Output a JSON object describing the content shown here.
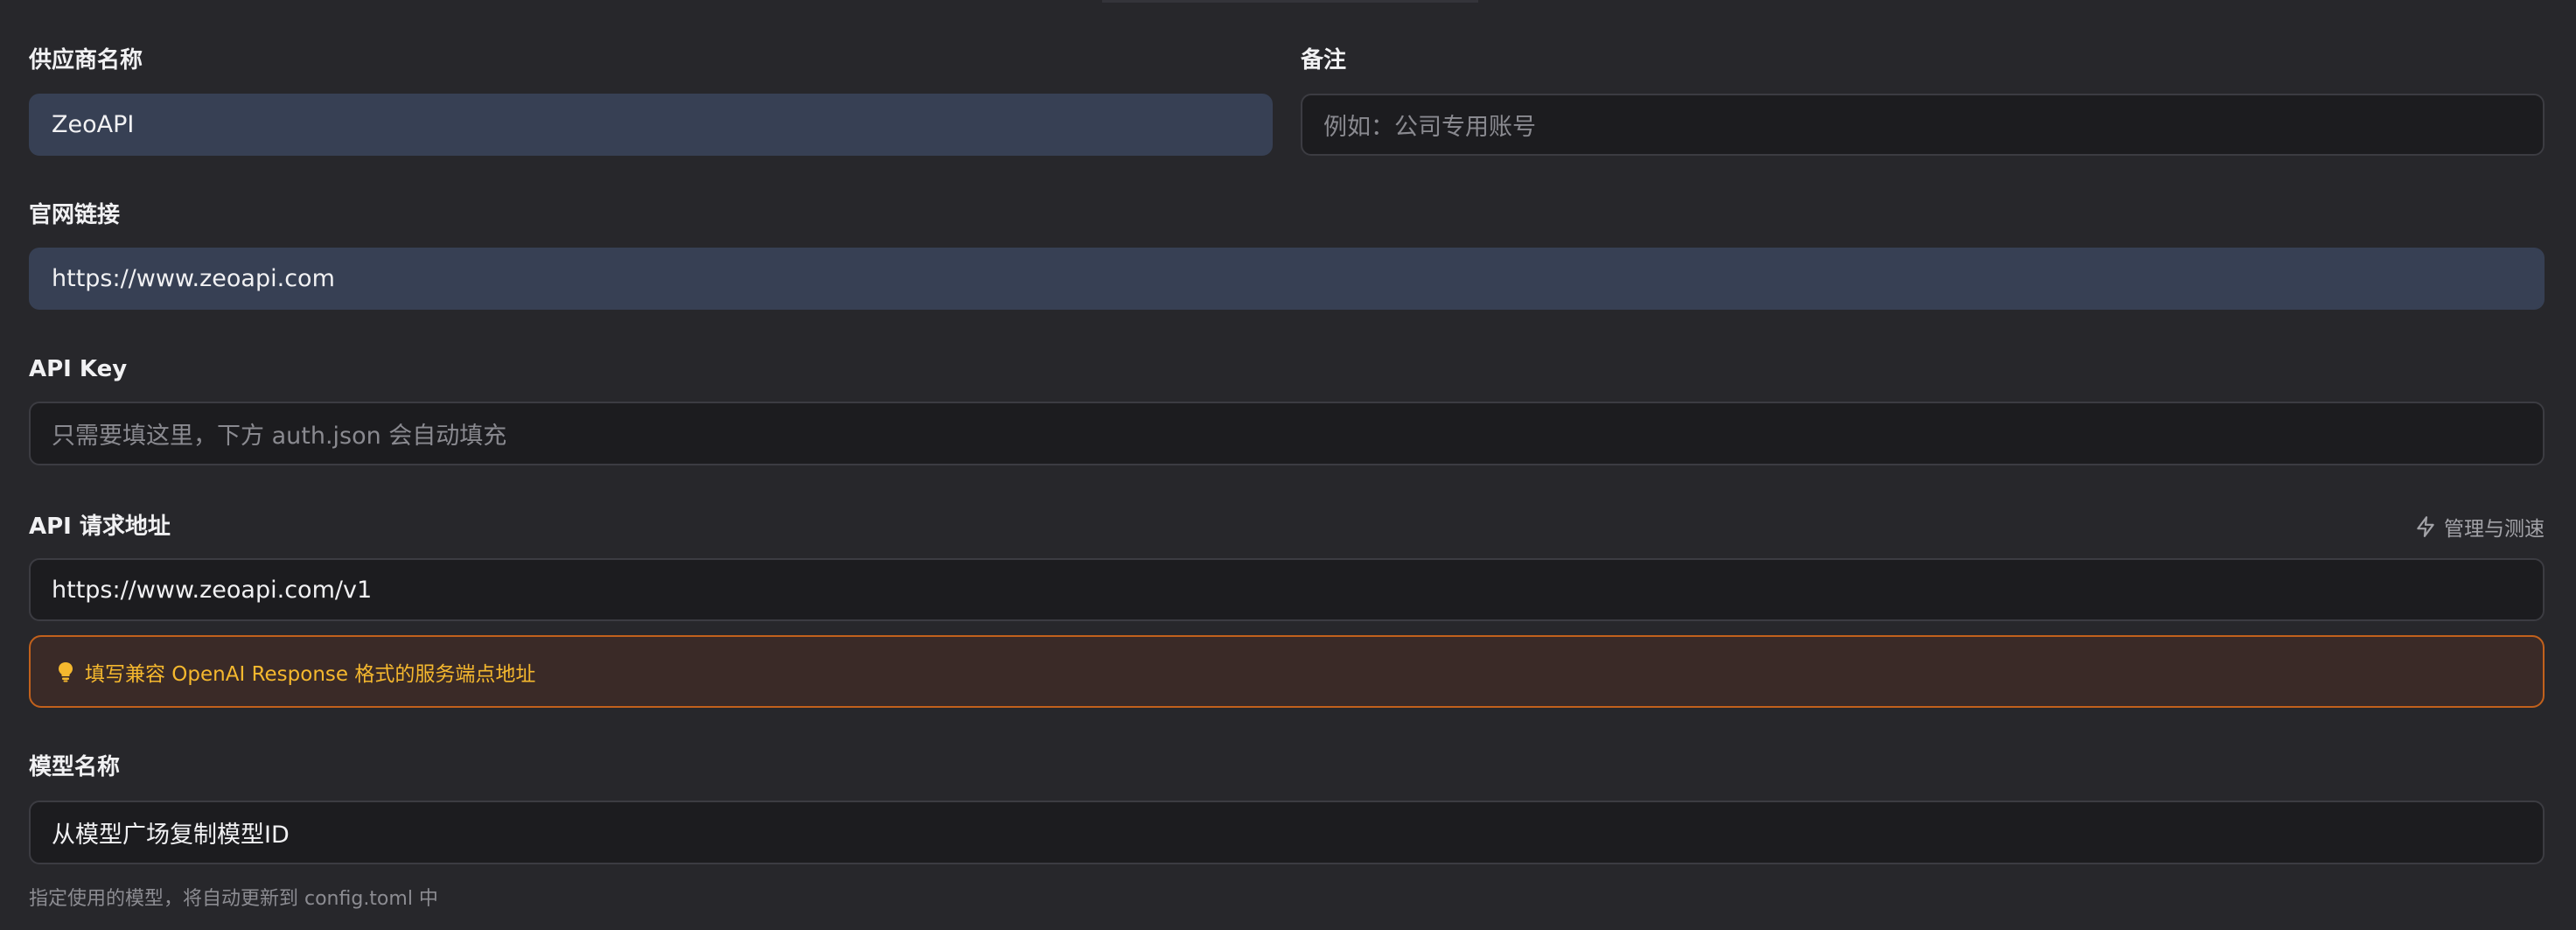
{
  "form": {
    "provider_name": {
      "label": "供应商名称",
      "value": "ZeoAPI"
    },
    "notes": {
      "label": "备注",
      "placeholder": "例如：公司专用账号"
    },
    "website": {
      "label": "官网链接",
      "value": "https://www.zeoapi.com"
    },
    "api_key": {
      "label": "API Key",
      "placeholder": "只需要填这里，下方 auth.json 会自动填充"
    },
    "api_endpoint": {
      "label": "API 请求地址",
      "action_label": "管理与测速",
      "action_icon": "lightning-icon",
      "value": "https://www.zeoapi.com/v1",
      "hint": "填写兼容 OpenAI Response 格式的服务端点地址",
      "hint_icon": "lightbulb-icon"
    },
    "model_name": {
      "label": "模型名称",
      "value": "从模型广场复制模型ID",
      "helper": "指定使用的模型，将自动更新到 config.toml 中"
    }
  },
  "colors": {
    "background": "#27272b",
    "input_background": "#1c1c1f",
    "filled_input_background": "#374054",
    "hint_border": "#c2611c",
    "hint_background": "#3a2a27",
    "hint_text": "#f5b82e"
  }
}
